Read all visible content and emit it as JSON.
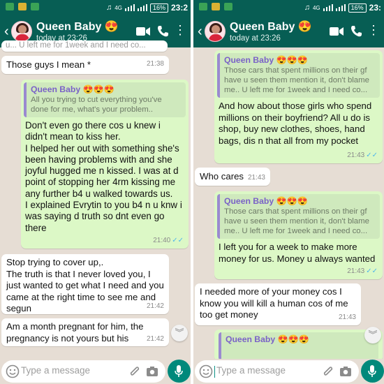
{
  "colors": {
    "header": "#075e54",
    "outgoing_bubble": "#dcf8c6",
    "incoming_bubble": "#ffffff",
    "quote_name": "#7a62c7",
    "read_ticks": "#4fb6ec",
    "mic_button": "#00897b"
  },
  "status_bar": {
    "left_glyphs": "✉",
    "time": "23:2",
    "time_right": "23:",
    "battery": "16%",
    "net": "4G"
  },
  "left": {
    "contact_name": "Queen Baby 😍",
    "status": "today at 23:26",
    "cut_top_text": "u...  U left me for 1week and I need co...",
    "messages": [
      {
        "text": "Those guys I mean *",
        "time": "21:38"
      },
      {
        "quote_name": "Queen Baby 😍😍😍",
        "quote_text": "All you trying to cut everything you've done for me, what's your problem..",
        "text": "Don't even go there cos u knew i didn't mean to kiss her.\nI helped her out with something she's been having problems with and she joyful hugged me n kissed. I was at d point of stopping her 4rm kissing me any further b4 u walked towards us.\nI explained Evrytin to you b4 n u knw i was saying d truth so dnt even go there",
        "time": "21:40"
      },
      {
        "text": "Stop trying to cover up,.\nThe truth is that I never loved you, I just wanted to get what I need and you came at the right time to see me and segun",
        "time": "21:42"
      },
      {
        "text": "Am a month pregnant for him, the pregnancy is not yours but his",
        "time": "21:42"
      }
    ]
  },
  "right": {
    "contact_name": "Queen Baby 😍",
    "status": "today at 23:26",
    "messages": [
      {
        "quote_name": "Queen Baby 😍😍😍",
        "quote_text": "Those cars that spent millions on their gf have u seen them mention it, don't blame me..  U left me for 1week and I need co...",
        "text": "And how about those girls who spend millions on their boyfriend? All u do is shop, buy new clothes, shoes, hand bags, dis n that all from my pocket",
        "time": "21:43"
      },
      {
        "text": "Who cares",
        "time": "21:43"
      },
      {
        "quote_name": "Queen Baby 😍😍😍",
        "quote_text": "Those cars that spent millions on their gf have u seen them mention it, don't blame me..  U left me for 1week and I need co...",
        "text": "I left you for a week to make more money for us. Money u always wanted",
        "time": "21:43"
      },
      {
        "text": "I needed more of your money cos I know you will kill a human cos of me too get money",
        "time": "21:43"
      },
      {
        "quote_name": "Queen Baby 😍😍😍"
      }
    ]
  },
  "input": {
    "placeholder": "Type a message"
  }
}
